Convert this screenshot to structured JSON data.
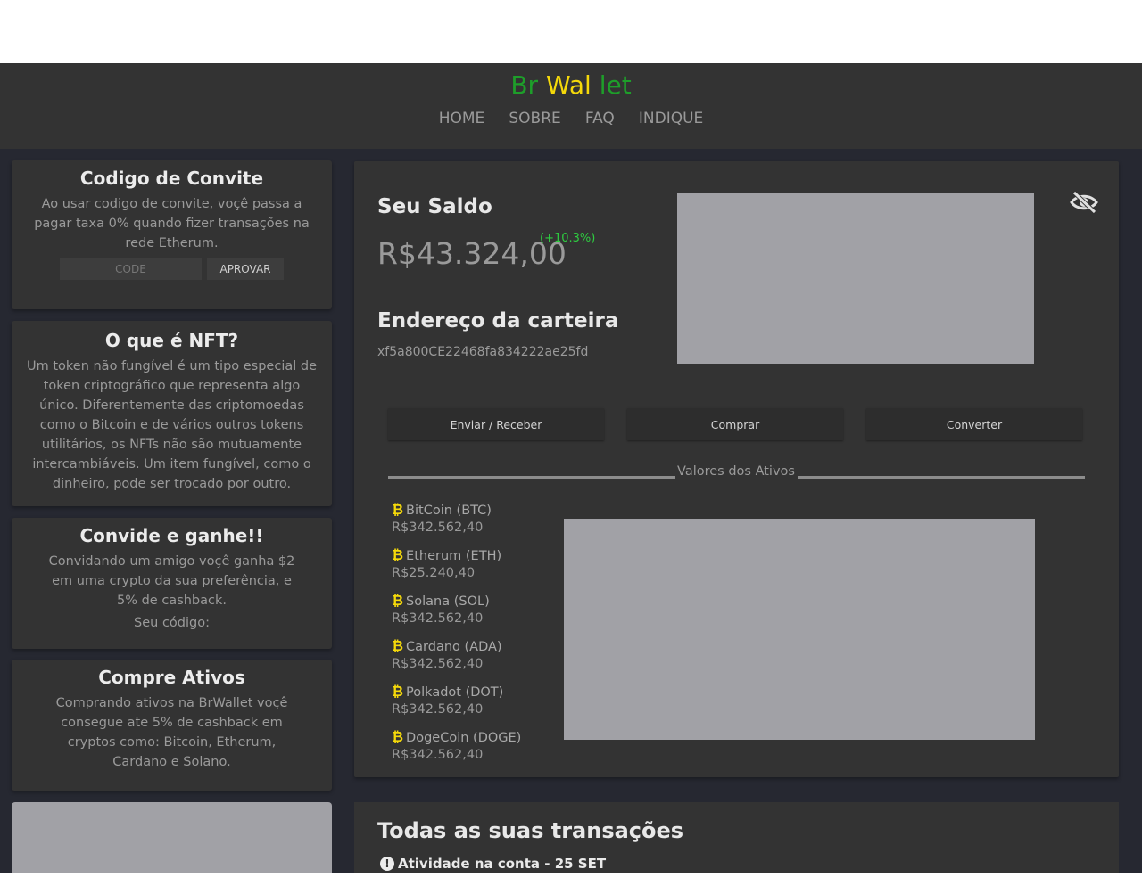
{
  "brand": {
    "part1": "Br",
    "part2": "Wal",
    "part3": "let",
    "color1": "#1e9e2a",
    "color2": "#f5d90a",
    "color3": "#1e9e2a"
  },
  "nav": {
    "home": "HOME",
    "sobre": "SOBRE",
    "faq": "FAQ",
    "indique": "INDIQUE"
  },
  "sidebar": {
    "invite": {
      "title": "Codigo de Convite",
      "text": "Ao usar codigo de convite, voçê passa a pagar taxa 0% quando fizer transações na rede Etherum.",
      "placeholder": "CODE",
      "button": "APROVAR"
    },
    "nft": {
      "title": "O que é NFT?",
      "text": "Um token não fungível é um tipo especial de token criptográfico que representa algo único. Diferentemente das criptomoedas como o Bitcoin e de vários outros tokens utilitários, os NFTs não são mutuamente intercambiáveis. Um item fungível, como o dinheiro, pode ser trocado por outro."
    },
    "refer": {
      "title": "Convide e ganhe!!",
      "text": "Convidando um amigo voçê ganha $2 em uma crypto da sua preferência, e 5% de cashback.",
      "code_label": "Seu código:"
    },
    "buy": {
      "title": "Compre Ativos",
      "text": "Comprando ativos na BrWallet voçê consegue ate 5% de cashback em cryptos como: Bitcoin, Etherum, Cardano e Solano."
    }
  },
  "wallet": {
    "balance_label": "Seu Saldo",
    "balance": "R$43.324,00",
    "change": "(+10.3%)",
    "address_label": "Endereço da carteira",
    "address": "xf5a800CE22468fa834222ae25fd",
    "actions": {
      "send": "Enviar / Receber",
      "buy": "Comprar",
      "convert": "Converter"
    },
    "assets_title": "Valores dos Ativos",
    "icon": "hide-eye-icon"
  },
  "assets": [
    {
      "name": "BitCoin (BTC)",
      "value": "R$342.562,40"
    },
    {
      "name": "Etherum (ETH)",
      "value": "R$25.240,40"
    },
    {
      "name": "Solana (SOL)",
      "value": "R$342.562,40"
    },
    {
      "name": "Cardano (ADA)",
      "value": "R$342.562,40"
    },
    {
      "name": "Polkadot (DOT)",
      "value": "R$342.562,40"
    },
    {
      "name": "DogeCoin (DOGE)",
      "value": "R$342.562,40"
    }
  ],
  "coin_symbol": "₿",
  "transactions": {
    "title": "Todas as suas transações",
    "activity": "Atividade na conta - 25 SET",
    "icon_glyph": "!"
  }
}
